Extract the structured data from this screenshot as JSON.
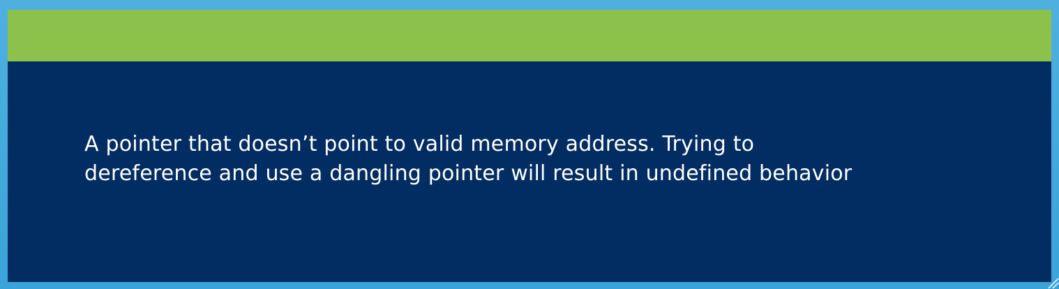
{
  "slide": {
    "body_line_1": "A pointer that doesn’t point to valid memory address. Trying to",
    "body_line_2": "dereference and use a dangling pointer will result in undefined behavior"
  },
  "colors": {
    "frame": "#4fb0e0",
    "slide_background": "#012d62",
    "title_band": "#8cc14b",
    "text": "#ffffff"
  }
}
